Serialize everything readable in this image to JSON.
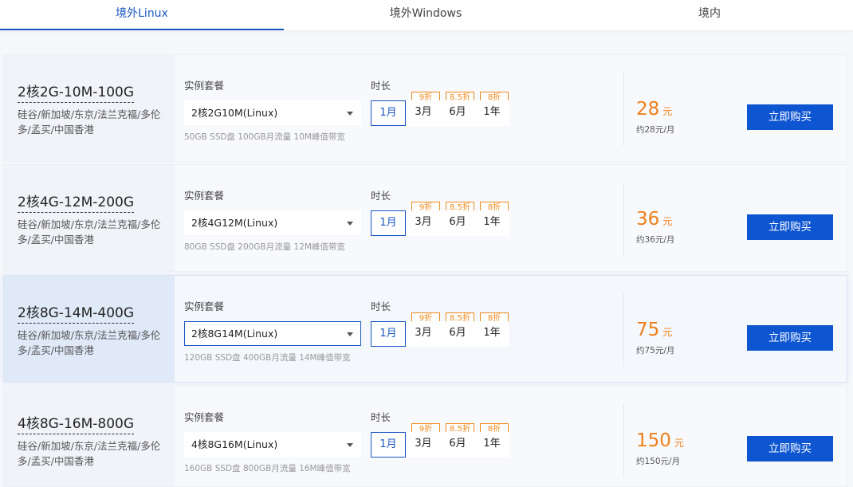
{
  "tabs": [
    {
      "label": "境外Linux",
      "active": true
    },
    {
      "label": "境外Windows",
      "active": false
    },
    {
      "label": "境内",
      "active": false
    }
  ],
  "labels": {
    "package": "实例套餐",
    "duration": "时长",
    "buy": "立即购买"
  },
  "durations": [
    "1月",
    "3月",
    "6月",
    "1年"
  ],
  "discounts": [
    "9折",
    "8.5折",
    "8折"
  ],
  "colors": {
    "accent": "#1a56c4",
    "buy_button": "#0d55d1",
    "price": "#ef7f1a",
    "discount_badge": "#ee8a1e"
  },
  "icons": {
    "select_caret": "chevron-down-icon"
  },
  "plans": [
    {
      "name": "2核2G-10M-100G",
      "regions": "硅谷/新加坡/东京/法兰克福/多伦多/孟买/中国香港",
      "package": "2核2G10M(Linux)",
      "desc": "50GB SSD盘 100GB月流量 10M峰值带宽",
      "price": "28",
      "unit": "元",
      "monthly": "约28元/月",
      "selected_duration": "1月",
      "active": false
    },
    {
      "name": "2核4G-12M-200G",
      "regions": "硅谷/新加坡/东京/法兰克福/多伦多/孟买/中国香港",
      "package": "2核4G12M(Linux)",
      "desc": "80GB SSD盘 200GB月流量 12M峰值带宽",
      "price": "36",
      "unit": "元",
      "monthly": "约36元/月",
      "selected_duration": "1月",
      "active": false
    },
    {
      "name": "2核8G-14M-400G",
      "regions": "硅谷/新加坡/东京/法兰克福/多伦多/孟买/中国香港",
      "package": "2核8G14M(Linux)",
      "desc": "120GB SSD盘 400GB月流量 14M峰值带宽",
      "price": "75",
      "unit": "元",
      "monthly": "约75元/月",
      "selected_duration": "1月",
      "active": true
    },
    {
      "name": "4核8G-16M-800G",
      "regions": "硅谷/新加坡/东京/法兰克福/多伦多/孟买/中国香港",
      "package": "4核8G16M(Linux)",
      "desc": "160GB SSD盘 800GB月流量 16M峰值带宽",
      "price": "150",
      "unit": "元",
      "monthly": "约150元/月",
      "selected_duration": "1月",
      "active": false
    }
  ]
}
